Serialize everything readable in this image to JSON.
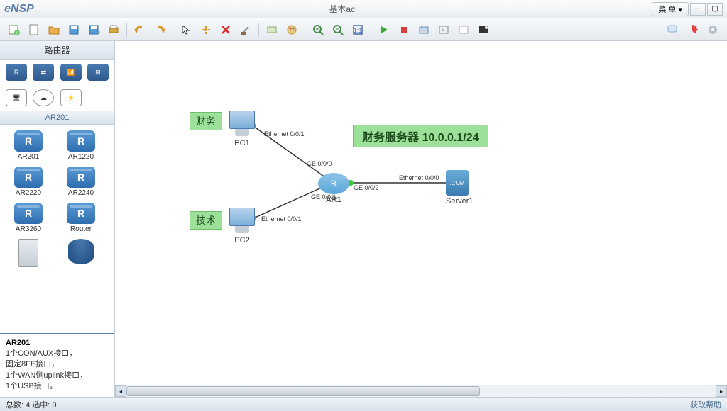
{
  "app": {
    "name": "eNSP",
    "title": "基本acl"
  },
  "menu": {
    "label": "菜 单"
  },
  "window": {
    "min": "—",
    "max": "▢",
    "close": "✕"
  },
  "toolbar_right": {
    "chat": "💬",
    "huawei": "✿",
    "gear": "⚙"
  },
  "sidebar": {
    "header": "路由器",
    "subheader": "AR201",
    "devices": [
      {
        "label": "AR201"
      },
      {
        "label": "AR1220"
      },
      {
        "label": "AR2220"
      },
      {
        "label": "AR2240"
      },
      {
        "label": "AR3260"
      },
      {
        "label": "Router"
      }
    ]
  },
  "info": {
    "title": "AR201",
    "lines": [
      "1个CON/AUX接口，",
      "固定8FE接口，",
      "1个WAN侧uplink接口，",
      "1个USB接口。"
    ]
  },
  "topology": {
    "tags": {
      "pc1": "财务",
      "pc2": "技术",
      "server": "财务服务器 10.0.0.1/24"
    },
    "nodes": {
      "pc1": "PC1",
      "pc2": "PC2",
      "rtr": "AR1",
      "srv": "Server1",
      "srv_badge": ".COM"
    },
    "interfaces": {
      "pc1_eth": "Ethernet 0/0/1",
      "pc2_eth": "Ethernet 0/0/1",
      "rtr_ge00": "GE 0/0/0",
      "rtr_ge01": "GE 0/0/1",
      "rtr_ge02": "GE 0/0/2",
      "srv_eth": "Ethernet 0/0/0"
    }
  },
  "status": {
    "left": "总数: 4 选中: 0",
    "right": "获取帮助"
  },
  "icons": {
    "pal_router": "R",
    "pal_switch": "⇄",
    "pal_wlan": "📶",
    "pal_fw": "⊞",
    "pal_pc": "🖥",
    "pal_cloud": "☁",
    "pal_line": "⚡"
  }
}
